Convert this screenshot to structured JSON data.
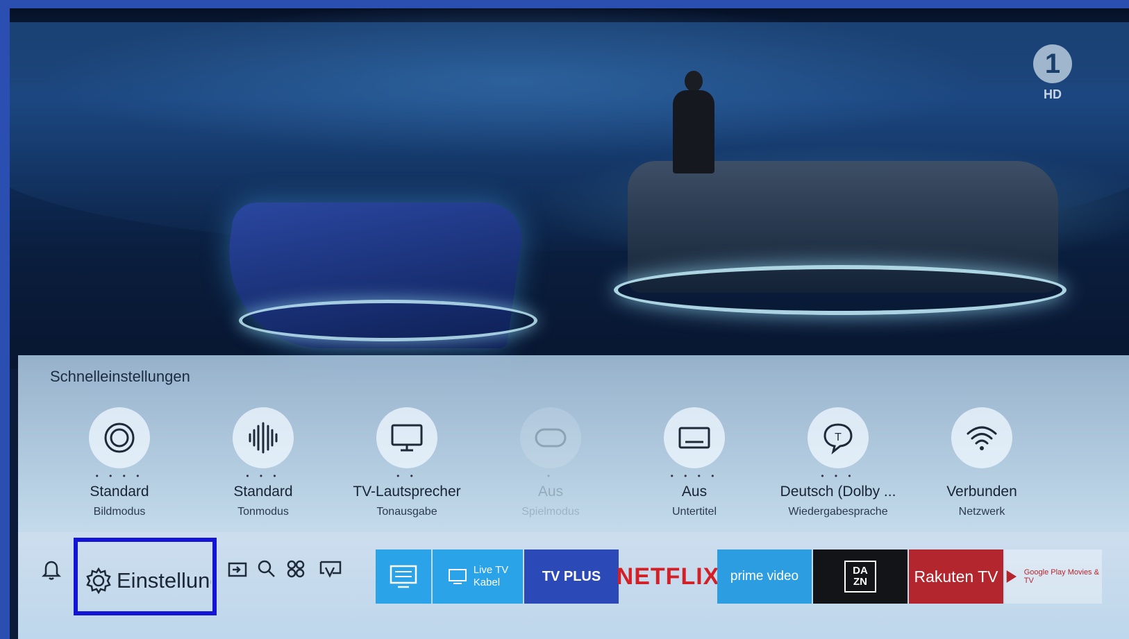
{
  "channel": {
    "logo": "1",
    "hd": "HD"
  },
  "quick_settings": {
    "title": "Schnelleinstellungen",
    "items": [
      {
        "value": "Standard",
        "label": "Bildmodus",
        "dots": "• • • •",
        "faded": false
      },
      {
        "value": "Standard",
        "label": "Tonmodus",
        "dots": "• • •",
        "faded": false
      },
      {
        "value": "TV-Lautsprecher",
        "label": "Tonausgabe",
        "dots": "• •",
        "faded": false
      },
      {
        "value": "Aus",
        "label": "Spielmodus",
        "dots": "•",
        "faded": true
      },
      {
        "value": "Aus",
        "label": "Untertitel",
        "dots": "• • • •",
        "faded": false
      },
      {
        "value": "Deutsch (Dolby ...",
        "label": "Wiedergabesprache",
        "dots": "• • •",
        "faded": false
      },
      {
        "value": "Verbunden",
        "label": "Netzwerk",
        "dots": "",
        "faded": false
      }
    ]
  },
  "bottom_bar": {
    "settings_label": "Einstellungen",
    "apps": {
      "live_tv": "Live TV",
      "live_tv_sub": "Kabel",
      "tvplus": "TV PLUS",
      "netflix": "NETFLIX",
      "prime": "prime video",
      "dazn": "DA ZN",
      "rakuten": "Rakuten TV",
      "gplay": "Google Play Movies & TV"
    }
  },
  "colors": {
    "highlight_border": "#1414d6",
    "netflix": "#d31f26",
    "rakuten": "#b3262d"
  }
}
